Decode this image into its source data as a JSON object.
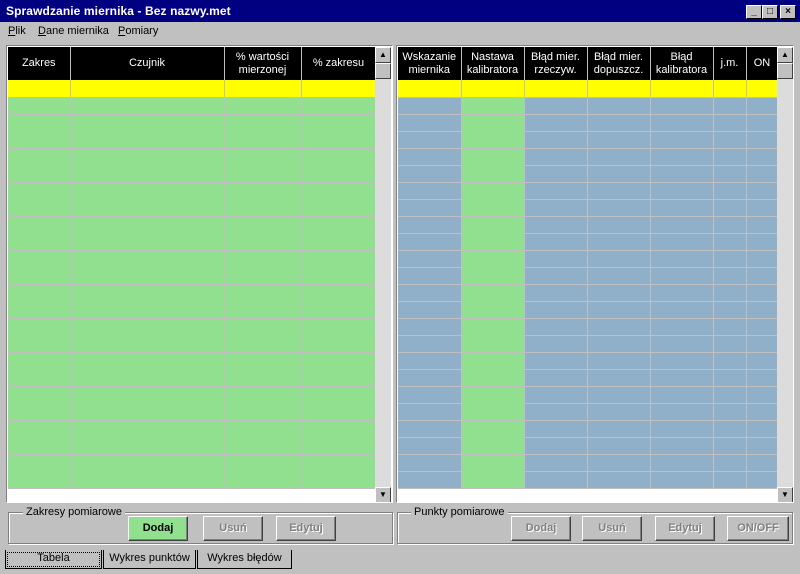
{
  "window": {
    "title": "Sprawdzanie miernika - Bez nazwy.met",
    "min_glyph": "_",
    "max_glyph": "□",
    "close_glyph": "×"
  },
  "menu": [
    "Plik",
    "Dane miernika",
    "Pomiary"
  ],
  "left_grid": {
    "columns": [
      "Zakres",
      "Czujnik",
      "% wartości mierzonej",
      "% zakresu"
    ],
    "visible_rows": 24,
    "selected_row_color": "#ffff00",
    "row_color": "#90e090"
  },
  "right_grid": {
    "columns": [
      "Wskazanie miernika",
      "Nastawa kalibratora",
      "Błąd mier. rzeczyw.",
      "Błąd mier. dopuszcz.",
      "Błąd kalibratora",
      "j.m.",
      "ON"
    ],
    "visible_rows": 24,
    "selected_row_color": "#ffff00",
    "input_column_color": "#90e090",
    "readonly_column_color": "#8fb0c8"
  },
  "scroll": {
    "up_glyph": "▲",
    "down_glyph": "▼"
  },
  "zakresy": {
    "legend": "Zakresy pomiarowe",
    "add": "Dodaj",
    "remove": "Usuń",
    "edit": "Edytuj"
  },
  "punkty": {
    "legend": "Punkty pomiarowe",
    "add": "Dodaj",
    "remove": "Usuń",
    "edit": "Edytuj",
    "toggle": "ON/OFF"
  },
  "tabs": [
    "Tabela",
    "Wykres punktów",
    "Wykres błędów"
  ]
}
